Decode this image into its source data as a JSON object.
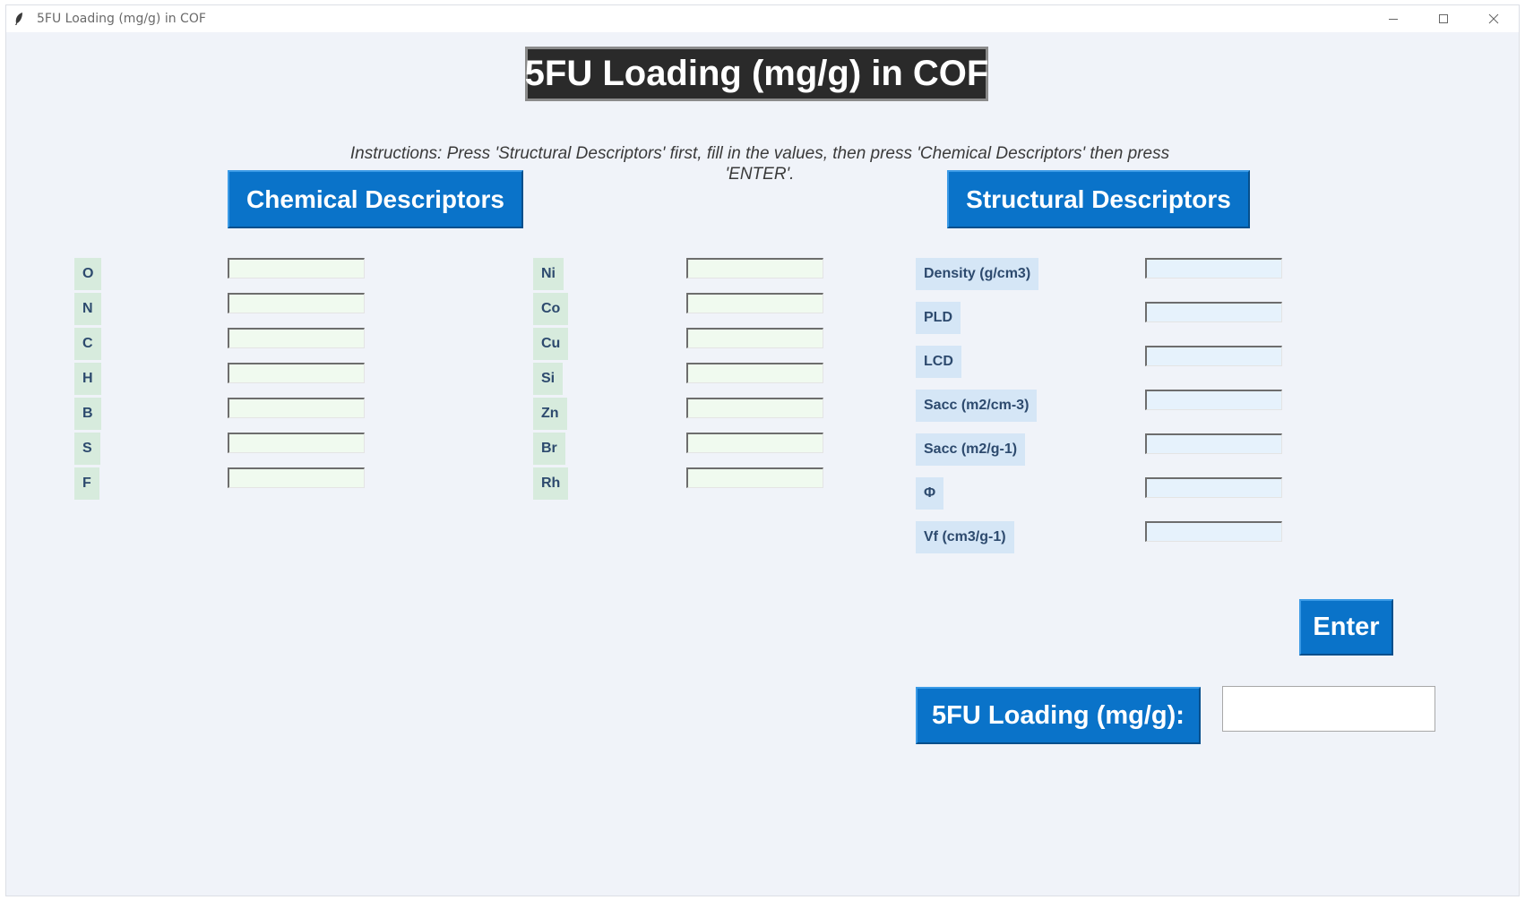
{
  "window": {
    "title": "5FU Loading (mg/g) in COF",
    "icon": "feather-icon",
    "controls": {
      "minimize": "minimize-icon",
      "maximize": "maximize-icon",
      "close": "close-icon"
    }
  },
  "header": {
    "title": "5FU Loading (mg/g) in COF",
    "instructions": "Instructions: Press 'Structural Descriptors' first, fill in the values, then press 'Chemical Descriptors' then press 'ENTER'."
  },
  "buttons": {
    "chemical": "Chemical Descriptors",
    "structural": "Structural Descriptors",
    "enter": "Enter",
    "result": "5FU Loading (mg/g):"
  },
  "chemical": {
    "col1": [
      "O",
      "N",
      "C",
      "H",
      "B",
      "S",
      "F"
    ],
    "col2": [
      "Ni",
      "Co",
      "Cu",
      "Si",
      "Zn",
      "Br",
      "Rh"
    ]
  },
  "structural": [
    "Density (g/cm3)",
    "PLD",
    "LCD",
    "Sacc (m2/cm-3)",
    "Sacc (m2/g-1)",
    "Φ",
    "Vf (cm3/g-1)"
  ],
  "values": {
    "chemical_col1": [
      "",
      "",
      "",
      "",
      "",
      "",
      ""
    ],
    "chemical_col2": [
      "",
      "",
      "",
      "",
      "",
      "",
      ""
    ],
    "structural": [
      "",
      "",
      "",
      "",
      "",
      "",
      ""
    ],
    "result": ""
  },
  "colors": {
    "button_blue": "#0a73c9",
    "chemical_label_bg": "#d7ebdd",
    "structural_label_bg": "#d5e6f6",
    "chemical_entry_bg": "#f0faef",
    "structural_entry_bg": "#e6f2fc",
    "background": "#f0f3f9"
  }
}
